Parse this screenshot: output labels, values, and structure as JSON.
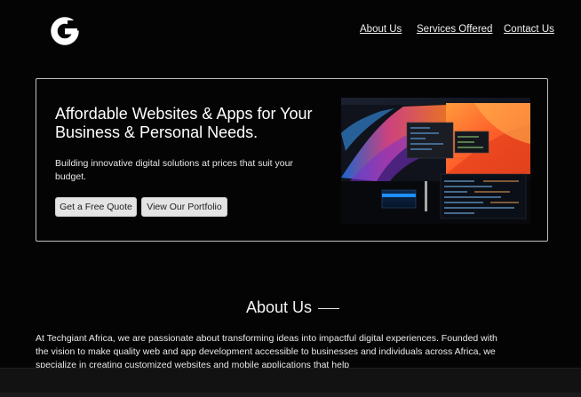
{
  "header": {
    "logo_letter": "G",
    "nav": [
      {
        "label": "About Us"
      },
      {
        "label": "Services Offered"
      },
      {
        "label": "Contact Us"
      }
    ]
  },
  "hero": {
    "title": "Affordable Websites & Apps for Your Business & Personal Needs.",
    "subtitle": "Building innovative digital solutions at prices that suit your budget.",
    "primary_button": "Get a Free Quote",
    "secondary_button": "View Our Portfolio",
    "image_icon": "developer-workspace-monitors-image"
  },
  "about": {
    "title": "About Us",
    "text": "At Techgiant Africa, we are passionate about transforming ideas into impactful digital experiences. Founded with the vision to make quality web and app development accessible to businesses and individuals across Africa, we specialize in creating customized websites and mobile applications that help"
  },
  "colors": {
    "background": "#040404",
    "hero_border": "#bfc1c7",
    "button_bg": "#e4e4e4",
    "text": "#f2f2f2"
  }
}
